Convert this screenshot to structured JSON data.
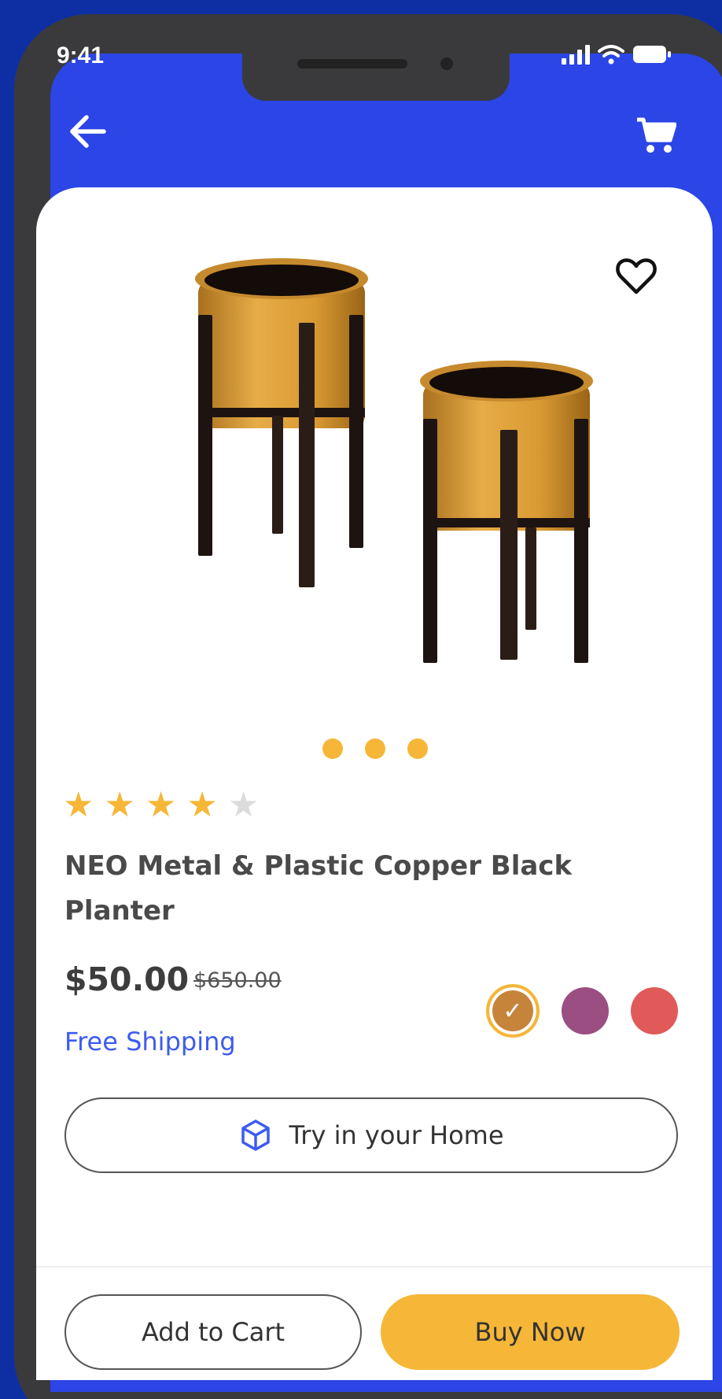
{
  "status_bar": {
    "time": "9:41"
  },
  "product": {
    "title": "NEO Metal & Plastic Copper Black Planter",
    "price": "$50.00",
    "original_price": "$650.00",
    "shipping": "Free Shipping",
    "rating": 4,
    "rating_max": 5,
    "image_count": 3,
    "swatches": [
      {
        "color": "#c6843a",
        "selected": true
      },
      {
        "color": "#9a4e82",
        "selected": false
      },
      {
        "color": "#e05a5a",
        "selected": false
      }
    ]
  },
  "actions": {
    "try_home": "Try in your Home",
    "add_to_cart": "Add to Cart",
    "buy_now": "Buy Now"
  },
  "colors": {
    "primary": "#2b45e6",
    "accent": "#f6b637",
    "link": "#3d5bf0"
  },
  "icons": {
    "back": "arrow-left-icon",
    "cart": "cart-icon",
    "wishlist": "heart-icon",
    "ar": "cube-icon"
  }
}
